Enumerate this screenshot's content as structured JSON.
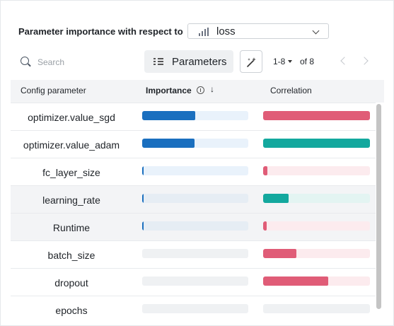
{
  "header": {
    "title": "Parameter importance with respect to"
  },
  "metric": {
    "label": "loss",
    "icon": "bar-chart-icon"
  },
  "search": {
    "placeholder": "Search",
    "value": ""
  },
  "toolbar": {
    "parameters_label": "Parameters",
    "magic_icon": "magic-wand-icon"
  },
  "pager": {
    "range": "1-8",
    "of_label": "of 8"
  },
  "table": {
    "columns": {
      "param": "Config parameter",
      "importance": "Importance",
      "correlation": "Correlation"
    },
    "colors": {
      "imp_fill": "#1a6fbf",
      "imp_track_a": "#e9f2fb",
      "imp_track_b": "#e6edf4",
      "neg_fill": "#e05c77",
      "neg_track": "#fcebee",
      "pos_fill": "#13a89e",
      "pos_track": "#e3f4f2",
      "empty_track": "#eff1f3"
    },
    "rows": [
      {
        "name": "optimizer.value_sgd",
        "importance": 0.5,
        "correlation": -1.0
      },
      {
        "name": "optimizer.value_adam",
        "importance": 0.49,
        "correlation": 1.0
      },
      {
        "name": "fc_layer_size",
        "importance": 0.01,
        "correlation": -0.04
      },
      {
        "name": "learning_rate",
        "importance": 0.01,
        "correlation": 0.24
      },
      {
        "name": "Runtime",
        "importance": 0.01,
        "correlation": -0.03
      },
      {
        "name": "batch_size",
        "importance": 0.0,
        "correlation": -0.31
      },
      {
        "name": "dropout",
        "importance": 0.0,
        "correlation": -0.61
      },
      {
        "name": "epochs",
        "importance": 0.0,
        "correlation": 0.0
      }
    ]
  }
}
